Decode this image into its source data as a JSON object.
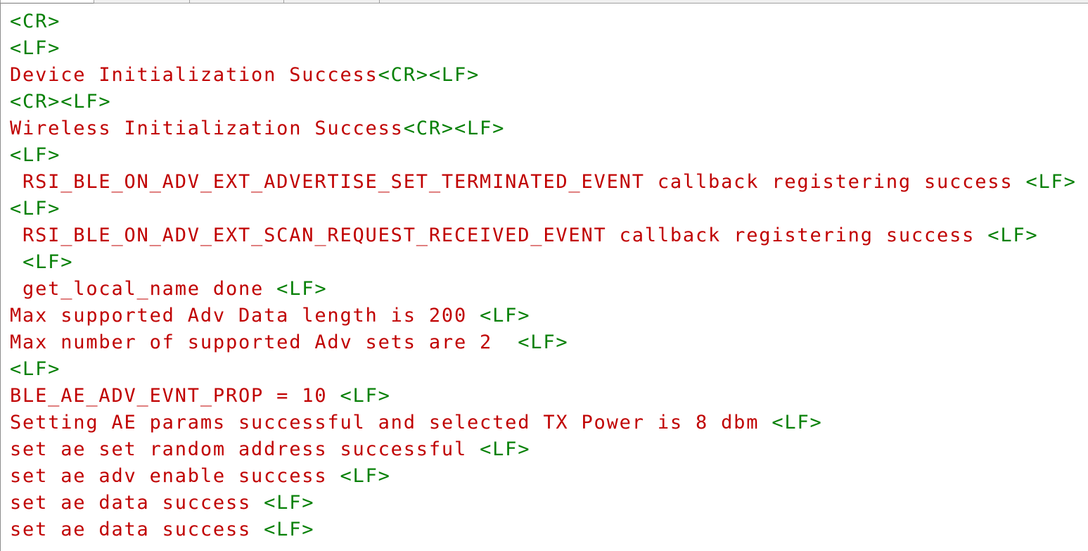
{
  "tabs": [
    "",
    "",
    "",
    ""
  ],
  "colors": {
    "control_char": "#068006",
    "message_text": "#c00000",
    "background": "#ffffff"
  },
  "log": {
    "lines": [
      [
        {
          "t": "ctrl",
          "v": "<CR>"
        }
      ],
      [
        {
          "t": "ctrl",
          "v": "<LF>"
        }
      ],
      [
        {
          "t": "text",
          "v": "Device Initialization Success"
        },
        {
          "t": "ctrl",
          "v": "<CR><LF>"
        }
      ],
      [
        {
          "t": "ctrl",
          "v": "<CR><LF>"
        }
      ],
      [
        {
          "t": "text",
          "v": "Wireless Initialization Success"
        },
        {
          "t": "ctrl",
          "v": "<CR><LF>"
        }
      ],
      [
        {
          "t": "ctrl",
          "v": "<LF>"
        }
      ],
      [
        {
          "t": "text",
          "v": " RSI_BLE_ON_ADV_EXT_ADVERTISE_SET_TERMINATED_EVENT callback registering success "
        },
        {
          "t": "ctrl",
          "v": "<LF>"
        }
      ],
      [
        {
          "t": "ctrl",
          "v": "<LF>"
        }
      ],
      [
        {
          "t": "text",
          "v": " RSI_BLE_ON_ADV_EXT_SCAN_REQUEST_RECEIVED_EVENT callback registering success "
        },
        {
          "t": "ctrl",
          "v": "<LF>"
        }
      ],
      [
        {
          "t": "text",
          "v": " "
        },
        {
          "t": "ctrl",
          "v": "<LF>"
        }
      ],
      [
        {
          "t": "text",
          "v": " get_local_name done "
        },
        {
          "t": "ctrl",
          "v": "<LF>"
        }
      ],
      [
        {
          "t": "text",
          "v": "Max supported Adv Data length is 200 "
        },
        {
          "t": "ctrl",
          "v": "<LF>"
        }
      ],
      [
        {
          "t": "text",
          "v": "Max number of supported Adv sets are 2  "
        },
        {
          "t": "ctrl",
          "v": "<LF>"
        }
      ],
      [
        {
          "t": "ctrl",
          "v": "<LF>"
        }
      ],
      [
        {
          "t": "text",
          "v": "BLE_AE_ADV_EVNT_PROP = 10 "
        },
        {
          "t": "ctrl",
          "v": "<LF>"
        }
      ],
      [
        {
          "t": "text",
          "v": "Setting AE params successful and selected TX Power is 8 dbm "
        },
        {
          "t": "ctrl",
          "v": "<LF>"
        }
      ],
      [
        {
          "t": "text",
          "v": "set ae set random address successful "
        },
        {
          "t": "ctrl",
          "v": "<LF>"
        }
      ],
      [
        {
          "t": "text",
          "v": "set ae adv enable success "
        },
        {
          "t": "ctrl",
          "v": "<LF>"
        }
      ],
      [
        {
          "t": "text",
          "v": "set ae data success "
        },
        {
          "t": "ctrl",
          "v": "<LF>"
        }
      ],
      [
        {
          "t": "text",
          "v": "set ae data success "
        },
        {
          "t": "ctrl",
          "v": "<LF>"
        }
      ]
    ]
  }
}
